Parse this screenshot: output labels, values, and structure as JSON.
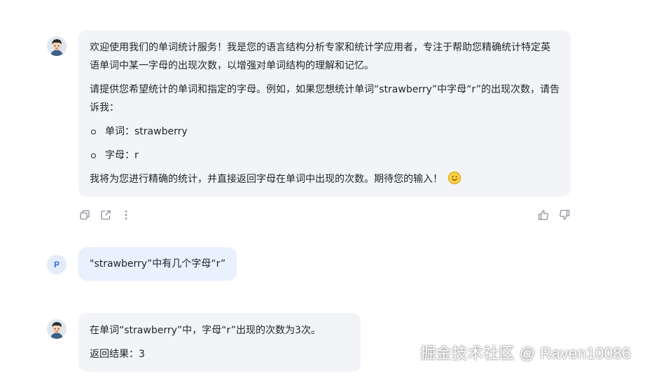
{
  "conversation": {
    "bot_message_1": {
      "para1": "欢迎使用我们的单词统计服务！我是您的语言结构分析专家和统计学应用者，专注于帮助您精确统计特定英语单词中某一字母的出现次数，以增强对单词结构的理解和记忆。",
      "para2": "请提供您希望统计的单词和指定的字母。例如，如果您想统计单词“strawberry”中字母“r”的出现次数，请告诉我：",
      "bullets": [
        "单词：strawberry",
        "字母：r"
      ],
      "para3": "我将为您进行精确的统计，并直接返回字母在单词中出现的次数。期待您的输入！",
      "emoji": "smiling-face-emoji"
    },
    "user_avatar_letter": "P",
    "user_message": "\"strawberry”中有几个字母“r”",
    "bot_message_2": {
      "line1": "在单词“strawberry”中，字母“r”出现的次数为3次。",
      "line2": "返回结果：3"
    }
  },
  "actions": {
    "icons": [
      "copy-icon",
      "share-icon",
      "more-icon",
      "thumbs-up-icon",
      "thumbs-down-icon"
    ]
  },
  "watermark": "掘金技术社区 @ Raven10086",
  "colors": {
    "bot_bubble": "#f3f4f7",
    "user_bubble": "#e9f1fe",
    "user_avatar_text": "#2f6de1"
  }
}
